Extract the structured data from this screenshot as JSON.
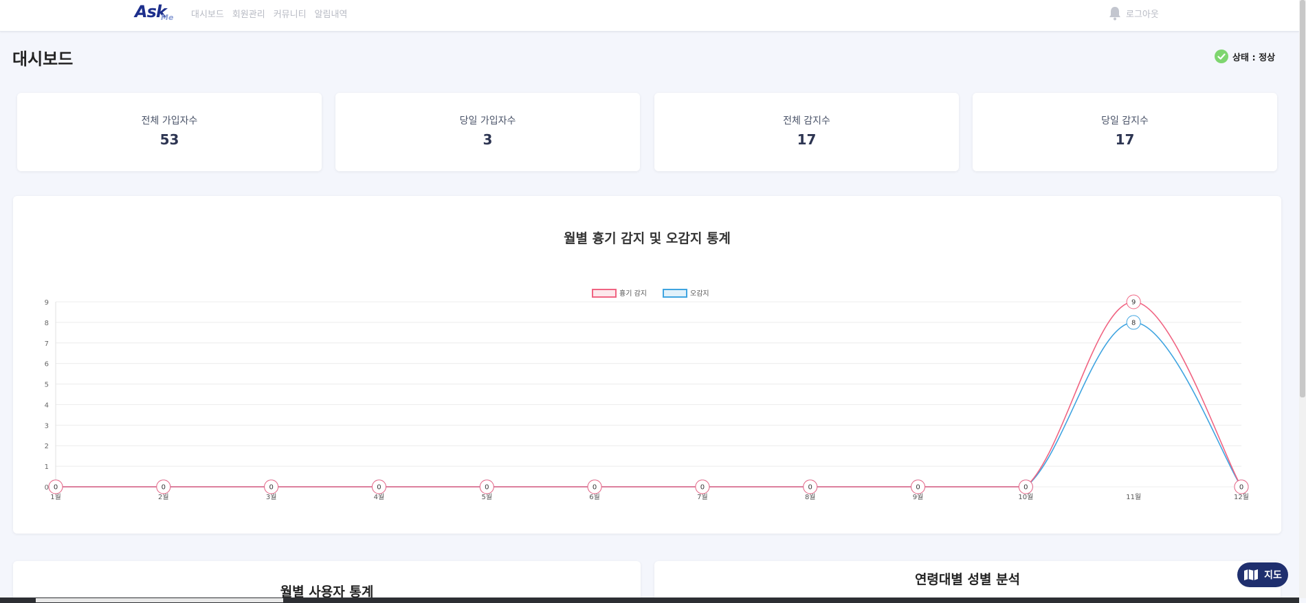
{
  "header": {
    "logo_text": "Ask",
    "logo_subtext": "Me",
    "nav": [
      {
        "label": "대시보드"
      },
      {
        "label": "회원관리"
      },
      {
        "label": "커뮤니티"
      },
      {
        "label": "알림내역"
      }
    ],
    "logout_label": "로그아웃"
  },
  "page": {
    "title": "대시보드",
    "status_text": "상태 : 정상",
    "status_color": "#7ed56f"
  },
  "stats": [
    {
      "label": "전체 가입자수",
      "value": "53"
    },
    {
      "label": "당일 가입자수",
      "value": "3"
    },
    {
      "label": "전체 감지수",
      "value": "17"
    },
    {
      "label": "당일 감지수",
      "value": "17"
    }
  ],
  "chart_data": {
    "type": "line",
    "title": "월별 흉기 감지 및 오감지 통계",
    "categories": [
      "1월",
      "2월",
      "3월",
      "4월",
      "5월",
      "6월",
      "7월",
      "8월",
      "9월",
      "10월",
      "11월",
      "12월"
    ],
    "series": [
      {
        "name": "흉기 감지",
        "color": "#f06482",
        "values": [
          0,
          0,
          0,
          0,
          0,
          0,
          0,
          0,
          0,
          0,
          9,
          0
        ]
      },
      {
        "name": "오감지",
        "color": "#3fa4e0",
        "values": [
          0,
          0,
          0,
          0,
          0,
          0,
          0,
          0,
          0,
          0,
          8,
          0
        ]
      }
    ],
    "ylim": [
      0,
      9
    ],
    "yticks": [
      0,
      1,
      2,
      3,
      4,
      5,
      6,
      7,
      8,
      9
    ],
    "legend": "top-center",
    "grid": true
  },
  "bottom_panels": [
    {
      "title": "월별 사용자 통계"
    },
    {
      "title": "연령대별 성별 분석"
    }
  ],
  "map_button": {
    "label": "지도"
  }
}
